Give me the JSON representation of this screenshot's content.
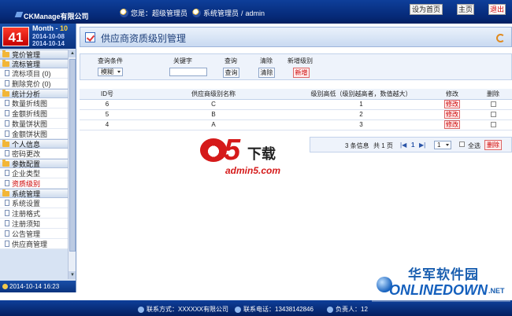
{
  "topbar": {
    "brand": "CKManage有限公司",
    "user_role": "您是：超级管理员",
    "user_name": "系统管理员",
    "user_sep": "/",
    "user_id": "admin",
    "btn_set_home": "设为首页",
    "btn_home": "主页",
    "btn_logout": "退出"
  },
  "datebox": {
    "day": "41",
    "month_label": "Month - ",
    "month_value": "10",
    "date_start": "2014-10-08",
    "date_end": "2014-10-14"
  },
  "sidebar": {
    "groups": [
      {
        "label": "竞价管理",
        "items": []
      },
      {
        "label": "流标管理",
        "items": [
          "流标项目 (0)",
          "删除竞价 (0)"
        ]
      },
      {
        "label": "统计分析",
        "items": [
          "数量折线图",
          "金额折线图",
          "数量饼状图",
          "金额饼状图"
        ]
      },
      {
        "label": "个人信息",
        "items": [
          "密码更改"
        ]
      },
      {
        "label": "参数配置",
        "items": [
          "企业类型",
          "资质级别"
        ]
      },
      {
        "label": "系统管理",
        "items": [
          "系统设置",
          "注册格式",
          "注册须知",
          "公告管理",
          "供应商管理"
        ]
      }
    ],
    "status_time": "2014-10-14 16:23"
  },
  "main": {
    "title": "供应商资质级别管理",
    "filter": {
      "cond_label": "查询条件",
      "cond_value": "模糊",
      "keyword_label": "关键字",
      "keyword_value": "",
      "query_label": "查询",
      "query_btn": "查询",
      "clear_label": "清除",
      "clear_btn": "清除",
      "add_label": "新增级别",
      "add_btn": "新增"
    },
    "table": {
      "headers": [
        "ID号",
        "供应商级别名称",
        "级别高低（级别越高者，数值越大）",
        "修改",
        "删除"
      ],
      "rows": [
        {
          "id": "6",
          "name": "C",
          "level": "1",
          "edit": "修改"
        },
        {
          "id": "5",
          "name": "B",
          "level": "2",
          "edit": "修改"
        },
        {
          "id": "4",
          "name": "A",
          "level": "3",
          "edit": "修改"
        }
      ]
    },
    "pager": {
      "info": "3 条信息",
      "total": "共 1 页",
      "current": "1",
      "select_value": "1",
      "select_all": "全选",
      "delete_btn": "删除"
    }
  },
  "footer": {
    "contact": "联系方式：XXXXXX有限公司",
    "phone": "联系电话：13438142846",
    "owner": "负责人：12"
  },
  "watermarks": {
    "a5_five": "5",
    "a5_text": "下载",
    "a5_url": "admin5.com",
    "onlinedown_cn": "华军软件园",
    "onlinedown_en": "ONLINEDOWN",
    "onlinedown_net": ".NET"
  }
}
